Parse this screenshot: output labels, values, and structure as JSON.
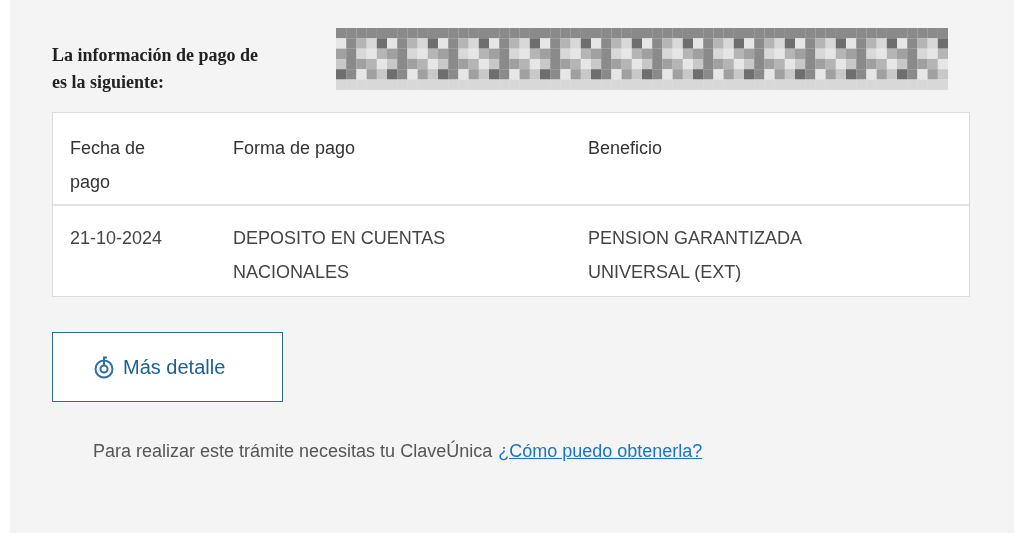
{
  "heading": {
    "line_1": "La información de pago de",
    "line_2": "es la siguiente:"
  },
  "table": {
    "columns": [
      "Fecha de pago",
      "Forma de pago",
      "Beneficio"
    ],
    "rows": [
      [
        "21-10-2024",
        "DEPOSITO EN CUENTAS NACIONALES",
        "PENSION GARANTIZADA UNIVERSAL (EXT)"
      ]
    ]
  },
  "button": {
    "label": "Más detalle"
  },
  "footer": {
    "text": "Para realizar este trámite necesitas tu ClaveÚnica",
    "link": "¿Cómo puedo obtenerla?"
  }
}
